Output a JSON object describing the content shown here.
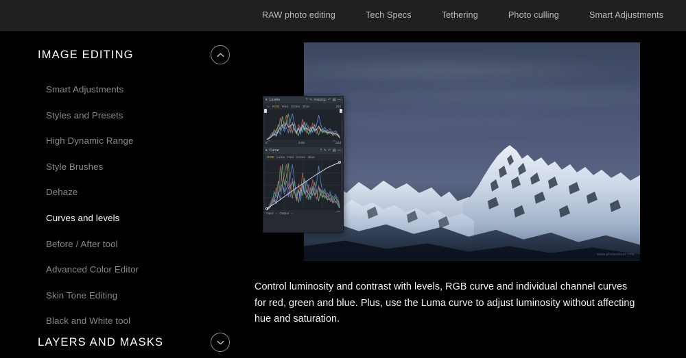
{
  "topnav": {
    "items": [
      {
        "label": "RAW photo editing"
      },
      {
        "label": "Tech Specs"
      },
      {
        "label": "Tethering"
      },
      {
        "label": "Photo culling"
      },
      {
        "label": "Smart Adjustments"
      }
    ]
  },
  "sidebar": {
    "sections": [
      {
        "title": "IMAGE EDITING",
        "toggle_icon": "chevron-up-icon",
        "expanded": true
      },
      {
        "title": "LAYERS AND MASKS",
        "toggle_icon": "chevron-down-icon",
        "expanded": false
      }
    ],
    "items": [
      {
        "label": "Smart Adjustments",
        "active": false
      },
      {
        "label": "Styles and Presets",
        "active": false
      },
      {
        "label": "High Dynamic Range",
        "active": false
      },
      {
        "label": "Style Brushes",
        "active": false
      },
      {
        "label": "Dehaze",
        "active": false
      },
      {
        "label": "Curves and levels",
        "active": true
      },
      {
        "label": "Before / After tool",
        "active": false
      },
      {
        "label": "Advanced Color Editor",
        "active": false
      },
      {
        "label": "Skin Tone Editing",
        "active": false
      },
      {
        "label": "Black and White tool",
        "active": false
      }
    ]
  },
  "main": {
    "photo": {
      "alt": "snow covered mountain ridge under dark blue sky",
      "watermark": "www.photoshoot.com"
    },
    "tool_panel": {
      "levels": {
        "title": "Levels",
        "collapse_icon": "chevron-down-icon",
        "header_icons": [
          "help-icon",
          "pencil-icon",
          "eyedropper-icon",
          "reset-icon",
          "preset-icon",
          "minus-icon"
        ],
        "tabs": [
          "RGB",
          "Red",
          "Green",
          "Blue"
        ],
        "selected_tab": "RGB",
        "max_value": "255",
        "black_point": "0",
        "gamma": "0.06",
        "white_point": "243"
      },
      "curve": {
        "title": "Curve",
        "collapse_icon": "chevron-down-icon",
        "header_icons": [
          "help-icon",
          "pencil-icon",
          "reset-icon",
          "preset-icon",
          "minus-icon"
        ],
        "tabs": [
          "RGB",
          "Luma",
          "Red",
          "Green",
          "Blue"
        ],
        "selected_tab": "RGB",
        "input_label": "Input",
        "input_value": "--",
        "output_label": "Output",
        "output_value": "--",
        "dropper_icon": "eyedropper-icon"
      }
    },
    "description": "Control luminosity and contrast with levels, RGB curve and individual channel curves for red, green and blue. Plus, use the Luma curve to adjust luminosity without affecting hue and saturation."
  },
  "colors": {
    "page_background": "#000000",
    "topnav_background": "#202020",
    "nav_link": "#b9b9b9",
    "section_title": "#ffffff",
    "nav_item": "#8a8a8a",
    "nav_item_active": "#ffffff",
    "description_text": "#f2f2f2",
    "panel_background": "#262b33",
    "panel_accent": "#e8a33c",
    "sky": "#4a5572"
  }
}
